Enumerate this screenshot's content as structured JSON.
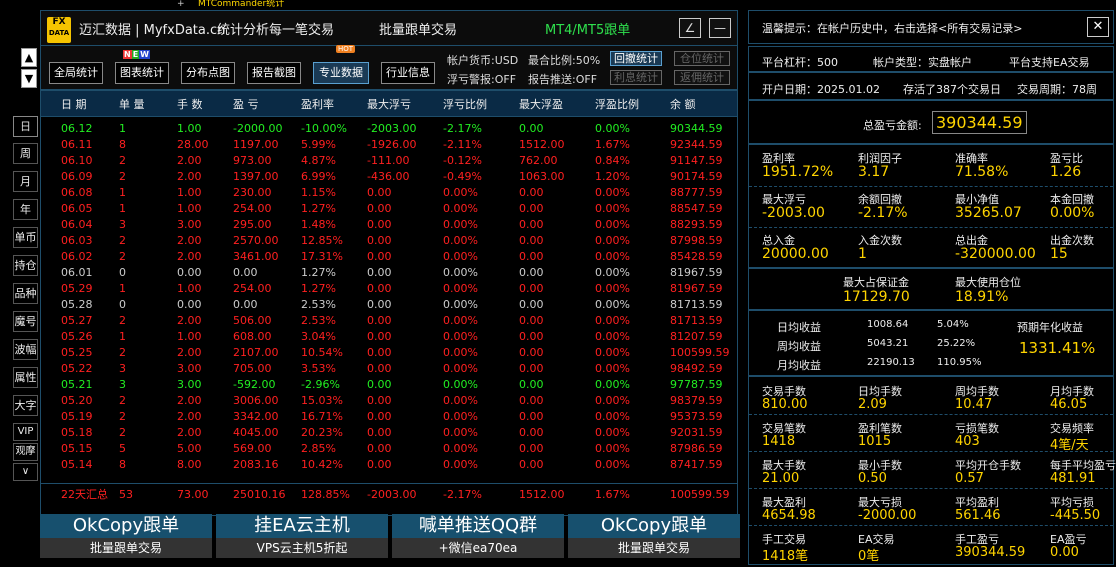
{
  "topbar": {
    "plus": "+",
    "title": "MTCommander统计"
  },
  "header": {
    "logo_line1": "FX",
    "logo_line2": "DATA",
    "brand": "迈汇数据 | MyfxData.cn",
    "slogan": "统计分析每一笔交易",
    "center": "批量跟单交易",
    "green": "MT4/MT5跟单",
    "edit_btn": "∠",
    "min_btn": "—"
  },
  "side": {
    "up": "▲",
    "down": "▼",
    "buttons": [
      "日",
      "周",
      "月",
      "年",
      "单币",
      "持仓",
      "品种",
      "魔号",
      "波幅",
      "属性",
      "大字",
      "VIP",
      "观摩",
      "∨"
    ]
  },
  "toolbar": {
    "buttons": [
      "全局统计",
      "图表统计",
      "分布点图",
      "报告截图",
      "专业数据",
      "行业信息"
    ],
    "new_badge": [
      "N",
      "E",
      "W"
    ],
    "hot_badge": "HOT",
    "opt1": "帐户货币:USD",
    "opt2": "最合比例:50%",
    "opt3": "浮亏警报:OFF",
    "opt4": "报告推送:OFF",
    "btn_a": "回撤统计",
    "btn_b": "仓位统计",
    "btn_c": "利息统计",
    "btn_d": "返佣统计"
  },
  "table": {
    "headers": [
      "日 期",
      "单 量",
      "手 数",
      "盈 亏",
      "盈利率",
      "最大浮亏",
      "浮亏比例",
      "最大浮盈",
      "浮盈比例",
      "余 额"
    ],
    "rows": [
      {
        "c": "green",
        "v": [
          "06.12",
          "1",
          "1.00",
          "-2000.00",
          "-10.00%",
          "-2003.00",
          "-2.17%",
          "0.00",
          "0.00%",
          "90344.59"
        ]
      },
      {
        "c": "red",
        "v": [
          "06.11",
          "8",
          "28.00",
          "1197.00",
          "5.99%",
          "-1926.00",
          "-2.11%",
          "1512.00",
          "1.67%",
          "92344.59"
        ]
      },
      {
        "c": "red",
        "v": [
          "06.10",
          "2",
          "2.00",
          "973.00",
          "4.87%",
          "-111.00",
          "-0.12%",
          "762.00",
          "0.84%",
          "91147.59"
        ]
      },
      {
        "c": "red",
        "v": [
          "06.09",
          "2",
          "2.00",
          "1397.00",
          "6.99%",
          "-436.00",
          "-0.49%",
          "1063.00",
          "1.20%",
          "90174.59"
        ]
      },
      {
        "c": "red",
        "v": [
          "06.08",
          "1",
          "1.00",
          "230.00",
          "1.15%",
          "0.00",
          "0.00%",
          "0.00",
          "0.00%",
          "88777.59"
        ]
      },
      {
        "c": "red",
        "v": [
          "06.05",
          "1",
          "1.00",
          "254.00",
          "1.27%",
          "0.00",
          "0.00%",
          "0.00",
          "0.00%",
          "88547.59"
        ]
      },
      {
        "c": "red",
        "v": [
          "06.04",
          "3",
          "3.00",
          "295.00",
          "1.48%",
          "0.00",
          "0.00%",
          "0.00",
          "0.00%",
          "88293.59"
        ]
      },
      {
        "c": "red",
        "v": [
          "06.03",
          "2",
          "2.00",
          "2570.00",
          "12.85%",
          "0.00",
          "0.00%",
          "0.00",
          "0.00%",
          "87998.59"
        ]
      },
      {
        "c": "red",
        "v": [
          "06.02",
          "2",
          "2.00",
          "3461.00",
          "17.31%",
          "0.00",
          "0.00%",
          "0.00",
          "0.00%",
          "85428.59"
        ]
      },
      {
        "c": "white",
        "v": [
          "06.01",
          "0",
          "0.00",
          "0.00",
          "1.27%",
          "0.00",
          "0.00%",
          "0.00",
          "0.00%",
          "81967.59"
        ]
      },
      {
        "c": "red",
        "v": [
          "05.29",
          "1",
          "1.00",
          "254.00",
          "1.27%",
          "0.00",
          "0.00%",
          "0.00",
          "0.00%",
          "81967.59"
        ]
      },
      {
        "c": "white",
        "v": [
          "05.28",
          "0",
          "0.00",
          "0.00",
          "2.53%",
          "0.00",
          "0.00%",
          "0.00",
          "0.00%",
          "81713.59"
        ]
      },
      {
        "c": "red",
        "v": [
          "05.27",
          "2",
          "2.00",
          "506.00",
          "2.53%",
          "0.00",
          "0.00%",
          "0.00",
          "0.00%",
          "81713.59"
        ]
      },
      {
        "c": "red",
        "v": [
          "05.26",
          "1",
          "1.00",
          "608.00",
          "3.04%",
          "0.00",
          "0.00%",
          "0.00",
          "0.00%",
          "81207.59"
        ]
      },
      {
        "c": "red",
        "v": [
          "05.25",
          "2",
          "2.00",
          "2107.00",
          "10.54%",
          "0.00",
          "0.00%",
          "0.00",
          "0.00%",
          "100599.59"
        ]
      },
      {
        "c": "red",
        "v": [
          "05.22",
          "3",
          "3.00",
          "705.00",
          "3.53%",
          "0.00",
          "0.00%",
          "0.00",
          "0.00%",
          "98492.59"
        ]
      },
      {
        "c": "green",
        "v": [
          "05.21",
          "3",
          "3.00",
          "-592.00",
          "-2.96%",
          "0.00",
          "0.00%",
          "0.00",
          "0.00%",
          "97787.59"
        ]
      },
      {
        "c": "red",
        "v": [
          "05.20",
          "2",
          "2.00",
          "3006.00",
          "15.03%",
          "0.00",
          "0.00%",
          "0.00",
          "0.00%",
          "98379.59"
        ]
      },
      {
        "c": "red",
        "v": [
          "05.19",
          "2",
          "2.00",
          "3342.00",
          "16.71%",
          "0.00",
          "0.00%",
          "0.00",
          "0.00%",
          "95373.59"
        ]
      },
      {
        "c": "red",
        "v": [
          "05.18",
          "2",
          "2.00",
          "4045.00",
          "20.23%",
          "0.00",
          "0.00%",
          "0.00",
          "0.00%",
          "92031.59"
        ]
      },
      {
        "c": "red",
        "v": [
          "05.15",
          "5",
          "5.00",
          "569.00",
          "2.85%",
          "0.00",
          "0.00%",
          "0.00",
          "0.00%",
          "87986.59"
        ]
      },
      {
        "c": "red",
        "v": [
          "05.14",
          "8",
          "8.00",
          "2083.16",
          "10.42%",
          "0.00",
          "0.00%",
          "0.00",
          "0.00%",
          "87417.59"
        ]
      }
    ],
    "summary": [
      "22天汇总",
      "53",
      "73.00",
      "25010.16",
      "128.85%",
      "-2003.00",
      "-2.17%",
      "1512.00",
      "1.67%",
      "100599.59"
    ]
  },
  "ads": [
    {
      "top": "OkCopy跟单",
      "bottom": "批量跟单交易"
    },
    {
      "top": "挂EA云主机",
      "bottom": "VPS云主机5折起"
    },
    {
      "top": "喊单推送QQ群",
      "bottom": "+微信ea70ea"
    },
    {
      "top": "OkCopy跟单",
      "bottom": "批量跟单交易"
    }
  ],
  "right": {
    "tip": "温馨提示：在帐户历史中，右击选择<所有交易记录>",
    "close": "✕",
    "leverage": "平台杠杆：500",
    "acct_type": "帐户类型：实盘帐户",
    "ea_support": "平台支持EA交易",
    "open_date": "开户日期：2025.01.02",
    "stored": "存活了387个交易日",
    "period": "交易周期：78周",
    "total_pl_label": "总盈亏金额:",
    "total_pl": "390344.59",
    "grid1": [
      {
        "l": "盈利率",
        "v": "1951.72%"
      },
      {
        "l": "利润因子",
        "v": "3.17"
      },
      {
        "l": "准确率",
        "v": "71.58%"
      },
      {
        "l": "盈亏比",
        "v": "1.26"
      },
      {
        "l": "最大浮亏",
        "v": "-2003.00"
      },
      {
        "l": "余额回撤",
        "v": "-2.17%"
      },
      {
        "l": "最小净值",
        "v": "35265.07"
      },
      {
        "l": "本金回撤",
        "v": "0.00%"
      },
      {
        "l": "总入金",
        "v": "20000.00"
      },
      {
        "l": "入金次数",
        "v": "1"
      },
      {
        "l": "总出金",
        "v": "-320000.00"
      },
      {
        "l": "出金次数",
        "v": "15"
      }
    ],
    "margin_label": "最大占保证金",
    "margin_val": "17129.70",
    "pos_label": "最大使用仓位",
    "pos_val": "18.91%",
    "daily": {
      "l": "日均收益",
      "a": "1008.64",
      "b": "5.04%"
    },
    "weekly": {
      "l": "周均收益",
      "a": "5043.21",
      "b": "25.22%"
    },
    "monthly": {
      "l": "月均收益",
      "a": "22190.13",
      "b": "110.95%"
    },
    "annual_label": "预期年化收益",
    "annual_val": "1331.41%",
    "grid2": [
      {
        "l": "交易手数",
        "v": "810.00"
      },
      {
        "l": "日均手数",
        "v": "2.09"
      },
      {
        "l": "周均手数",
        "v": "10.47"
      },
      {
        "l": "月均手数",
        "v": "46.05"
      },
      {
        "l": "交易笔数",
        "v": "1418"
      },
      {
        "l": "盈利笔数",
        "v": "1015"
      },
      {
        "l": "亏损笔数",
        "v": "403"
      },
      {
        "l": "交易频率",
        "v": "4笔/天"
      },
      {
        "l": "最大手数",
        "v": "21.00"
      },
      {
        "l": "最小手数",
        "v": "0.50"
      },
      {
        "l": "平均开仓手数",
        "v": "0.57"
      },
      {
        "l": "每手平均盈亏",
        "v": "481.91"
      },
      {
        "l": "最大盈利",
        "v": "4654.98"
      },
      {
        "l": "最大亏损",
        "v": "-2000.00"
      },
      {
        "l": "平均盈利",
        "v": "561.46"
      },
      {
        "l": "平均亏损",
        "v": "-445.50"
      },
      {
        "l": "手工交易",
        "v": "1418笔"
      },
      {
        "l": "EA交易",
        "v": "0笔"
      },
      {
        "l": "手工盈亏",
        "v": "390344.59"
      },
      {
        "l": "EA盈亏",
        "v": "0.00"
      }
    ]
  }
}
